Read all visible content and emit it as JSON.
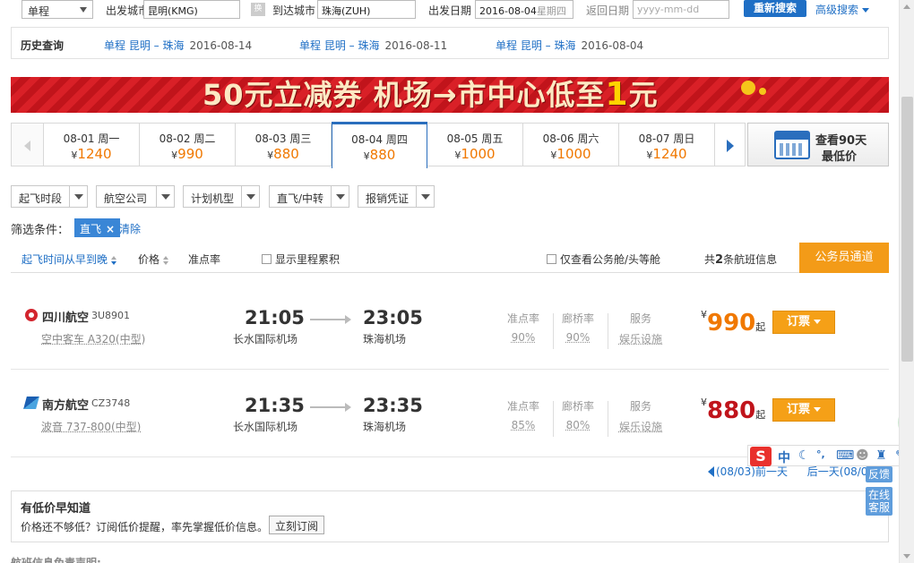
{
  "search": {
    "trip_type": "单程",
    "from_label": "出发城市",
    "from_value": "昆明(KMG)",
    "swap_label": "换",
    "to_label": "到达城市",
    "to_value": "珠海(ZUH)",
    "depart_label": "出发日期",
    "depart_value": "2016-08-04",
    "depart_weekday": "星期四",
    "return_label": "返回日期",
    "return_placeholder": "yyyy-mm-dd",
    "search_button": "重新搜索",
    "advanced": "高级搜索"
  },
  "history": {
    "title": "历史查询",
    "items": [
      {
        "route": "单程 昆明 – 珠海",
        "date": "2016-08-14"
      },
      {
        "route": "单程 昆明 – 珠海",
        "date": "2016-08-11"
      },
      {
        "route": "单程 昆明 – 珠海",
        "date": "2016-08-04"
      }
    ]
  },
  "banner": {
    "text": "50元立减券 机场→市中心低至",
    "highlight": "1",
    "suffix": "元"
  },
  "dates": [
    {
      "date": "08-01 周一",
      "price": "1240"
    },
    {
      "date": "08-02 周二",
      "price": "990"
    },
    {
      "date": "08-03 周三",
      "price": "880"
    },
    {
      "date": "08-04 周四",
      "price": "880",
      "active": true
    },
    {
      "date": "08-05 周五",
      "price": "1000"
    },
    {
      "date": "08-06 周六",
      "price": "1000"
    },
    {
      "date": "08-07 周日",
      "price": "1240"
    }
  ],
  "currency": "¥",
  "lowest90": {
    "line1": "查看90天",
    "line2": "最低价"
  },
  "filters": [
    "起飞时段",
    "航空公司",
    "计划机型",
    "直飞/中转",
    "报销凭证"
  ],
  "conditions": {
    "label": "筛选条件：",
    "tag": "直飞",
    "tag_close": "×",
    "clear": "清除"
  },
  "sort": {
    "by_time": "起飞时间从早到晚",
    "by_price": "价格",
    "by_ontime": "准点率",
    "show_mileage": "显示里程累积",
    "business_only": "仅查看公务舱/头等舱",
    "count_prefix": "共",
    "count": "2",
    "count_suffix": "条航班信息",
    "gov_button": "公务员通道"
  },
  "flights": [
    {
      "airline": "四川航空",
      "flight_no": "3U8901",
      "plane": "空中客车 A320(中型)",
      "dep_time": "21:05",
      "dep_airport": "长水国际机场",
      "arr_time": "23:05",
      "arr_airport": "珠海机场",
      "ontime_label": "准点率",
      "ontime": "90%",
      "bridge_label": "廊桥率",
      "bridge": "90%",
      "service_label": "服务",
      "service": "娱乐设施",
      "price": "990",
      "price_color": "#f07800",
      "price_suffix": "起",
      "book": "订票"
    },
    {
      "airline": "南方航空",
      "flight_no": "CZ3748",
      "plane": "波音 737-800(中型)",
      "dep_time": "21:35",
      "dep_airport": "长水国际机场",
      "arr_time": "23:35",
      "arr_airport": "珠海机场",
      "ontime_label": "准点率",
      "ontime": "85%",
      "bridge_label": "廊桥率",
      "bridge": "80%",
      "service_label": "服务",
      "service": "娱乐设施",
      "price": "880",
      "price_color": "#c0141b",
      "price_suffix": "起",
      "book": "订票"
    }
  ],
  "pager": {
    "prev": "(08/03)前一天",
    "next": "后一天(08/0"
  },
  "lowprice": {
    "title": "有低价早知道",
    "desc": "价格还不够低？订阅低价提醒，率先掌握低价信息。",
    "button": "立刻订阅"
  },
  "cutoff_text": "航班信息免责声明:",
  "side": {
    "feedback": "反馈",
    "service": "在线客服",
    "green": "60"
  },
  "ime": {
    "logo": "S",
    "lang": "中"
  }
}
